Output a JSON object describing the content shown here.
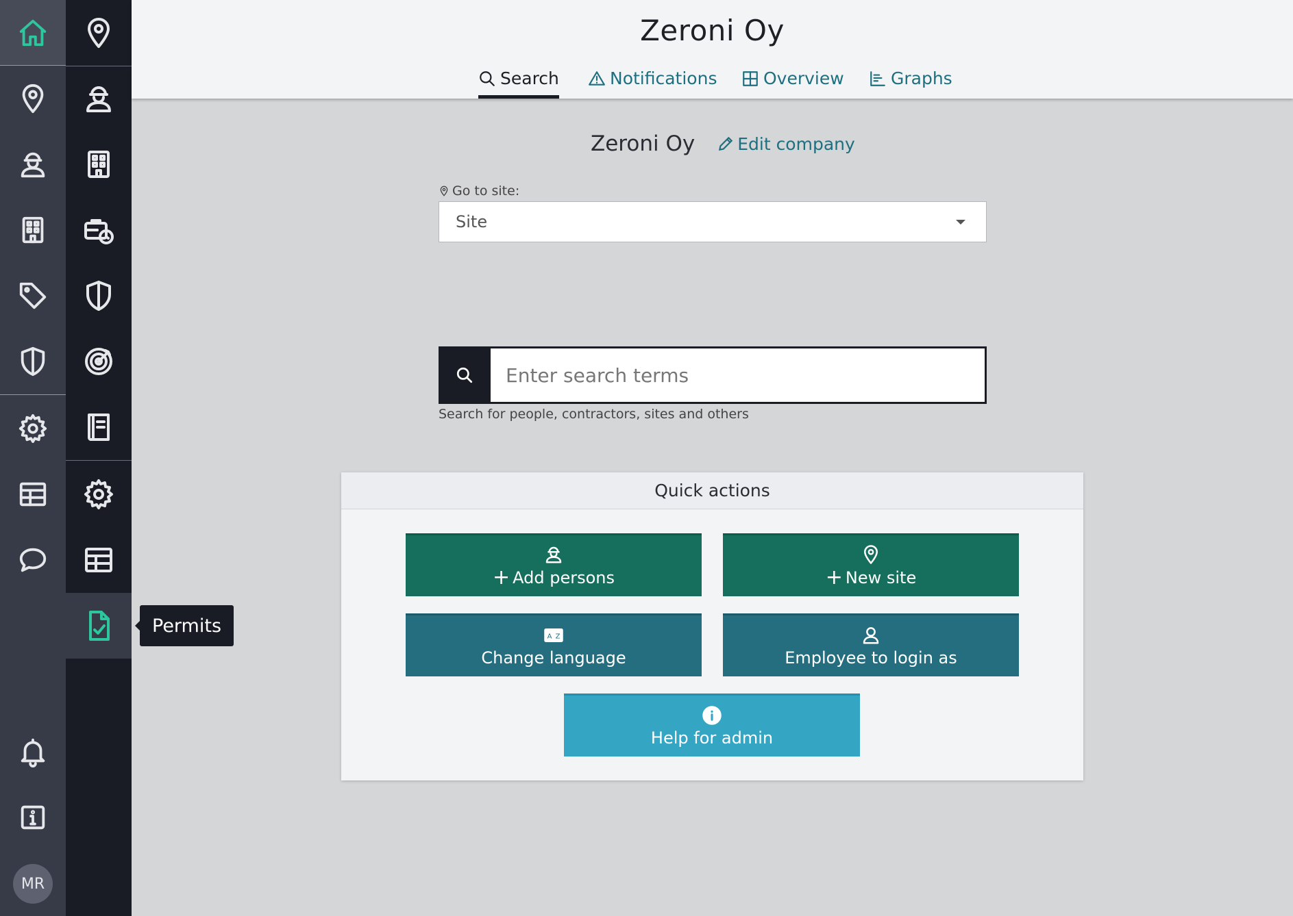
{
  "colors": {
    "rail_primary": "#373a47",
    "rail_secondary": "#191b25",
    "accent_green": "#2ec79d",
    "link": "#1e6f80",
    "btn_green": "#166f5d",
    "btn_teal": "#246e80",
    "btn_light": "#35a5c4"
  },
  "rail1": {
    "icons": [
      "home-icon",
      "map-pin-icon",
      "worker-icon",
      "building-icon",
      "tag-icon",
      "shield-icon",
      "gear-icon",
      "table-icon",
      "chat-icon",
      "bell-icon",
      "info-icon"
    ],
    "avatar_initials": "MR"
  },
  "rail2": {
    "icons": [
      "map-pin-icon",
      "worker-icon",
      "building-icon",
      "briefcase-clock-icon",
      "shield-icon",
      "target-icon",
      "book-icon",
      "gear-icon",
      "table-icon",
      "document-check-icon"
    ],
    "tooltip": "Permits"
  },
  "header": {
    "title": "Zeroni Oy",
    "tabs": [
      {
        "label": "Search",
        "icon": "search-icon",
        "active": true
      },
      {
        "label": "Notifications",
        "icon": "warning-icon",
        "active": false
      },
      {
        "label": "Overview",
        "icon": "grid-icon",
        "active": false
      },
      {
        "label": "Graphs",
        "icon": "chart-icon",
        "active": false
      }
    ]
  },
  "company": {
    "name": "Zeroni Oy",
    "edit_label": "Edit company"
  },
  "site": {
    "label": "Go to site:",
    "placeholder": "Site"
  },
  "search": {
    "placeholder": "Enter search terms",
    "help": "Search for people, contractors, sites and others"
  },
  "quick_actions": {
    "title": "Quick actions",
    "buttons": [
      {
        "label": "Add persons",
        "icon": "worker-icon"
      },
      {
        "label": "New site",
        "icon": "map-pin-icon"
      },
      {
        "label": "Change language",
        "icon": "language-icon"
      },
      {
        "label": "Employee to login as",
        "icon": "user-icon"
      },
      {
        "label": "Help for admin",
        "icon": "info-circle-icon"
      }
    ]
  }
}
